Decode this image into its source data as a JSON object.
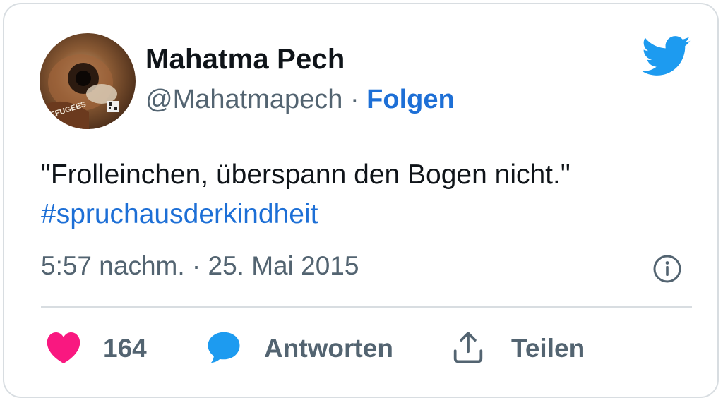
{
  "author": {
    "display_name": "Mahatma Pech",
    "handle": "@Mahatmapech",
    "separator": " · ",
    "follow_label": "Folgen"
  },
  "tweet": {
    "text": "\"Frolleinchen, überspann den Bogen nicht.\"",
    "hashtag": "#spruchausderkindheit",
    "timestamp": "5:57 nachm. · 25. Mai 2015"
  },
  "actions": {
    "like_count": "164",
    "reply_label": "Antworten",
    "share_label": "Teilen"
  },
  "icons": {
    "brand": "twitter-bird-icon",
    "info": "info-icon",
    "like": "heart-icon",
    "reply": "speech-bubble-icon",
    "share": "share-upload-icon"
  },
  "colors": {
    "link_blue": "#1d6fd6",
    "twitter_blue": "#1d9bf0",
    "heart_pink": "#f91880",
    "text_primary": "#0f1419",
    "text_secondary": "#536471"
  }
}
